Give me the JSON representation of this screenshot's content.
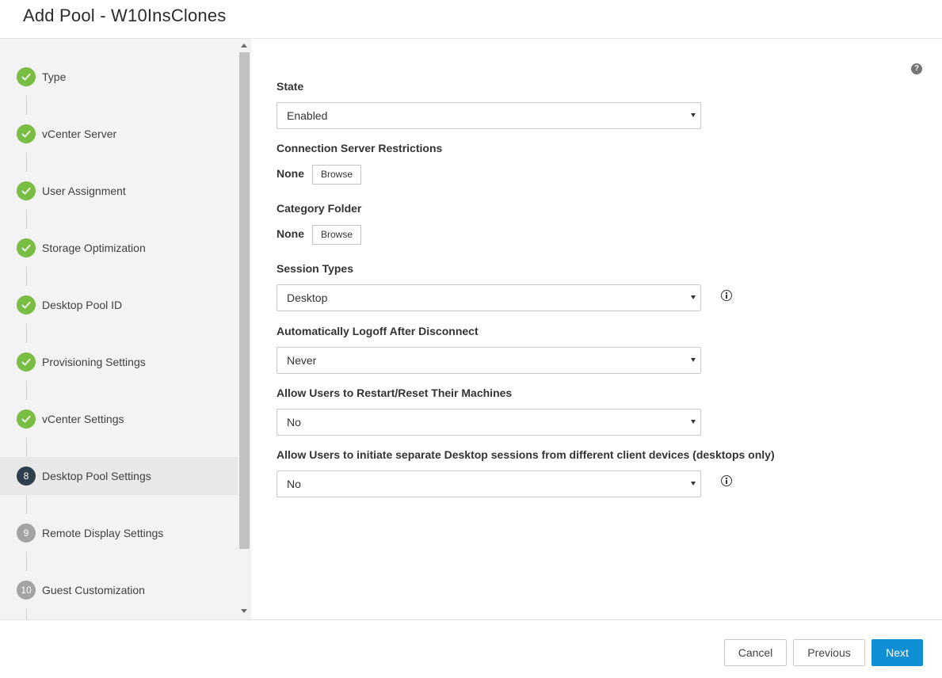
{
  "dialog": {
    "title": "Add Pool - W10InsClones"
  },
  "sidebar": {
    "steps": [
      {
        "number": "1",
        "label": "Type",
        "status": "done"
      },
      {
        "number": "2",
        "label": "vCenter Server",
        "status": "done"
      },
      {
        "number": "3",
        "label": "User Assignment",
        "status": "done"
      },
      {
        "number": "4",
        "label": "Storage Optimization",
        "status": "done"
      },
      {
        "number": "5",
        "label": "Desktop Pool ID",
        "status": "done"
      },
      {
        "number": "6",
        "label": "Provisioning Settings",
        "status": "done"
      },
      {
        "number": "7",
        "label": "vCenter Settings",
        "status": "done"
      },
      {
        "number": "8",
        "label": "Desktop Pool Settings",
        "status": "current"
      },
      {
        "number": "9",
        "label": "Remote Display Settings",
        "status": "future"
      },
      {
        "number": "10",
        "label": "Guest Customization",
        "status": "future"
      }
    ]
  },
  "form": {
    "help_icon": "?",
    "state": {
      "label": "State",
      "value": "Enabled"
    },
    "connection_server_restrictions": {
      "label": "Connection Server Restrictions",
      "value": "None",
      "browse_label": "Browse"
    },
    "category_folder": {
      "label": "Category Folder",
      "value": "None",
      "browse_label": "Browse"
    },
    "session_types": {
      "label": "Session Types",
      "value": "Desktop"
    },
    "auto_logoff": {
      "label": "Automatically Logoff After Disconnect",
      "value": "Never"
    },
    "allow_restart": {
      "label": "Allow Users to Restart/Reset Their Machines",
      "value": "No"
    },
    "allow_separate_sessions": {
      "label": "Allow Users to initiate separate Desktop sessions from different client devices (desktops only)",
      "value": "No"
    }
  },
  "footer": {
    "cancel_label": "Cancel",
    "previous_label": "Previous",
    "next_label": "Next"
  },
  "colors": {
    "accent": "#0f8fd6",
    "done": "#78be43",
    "current": "#2f3e4c",
    "future": "#a3a3a3"
  }
}
